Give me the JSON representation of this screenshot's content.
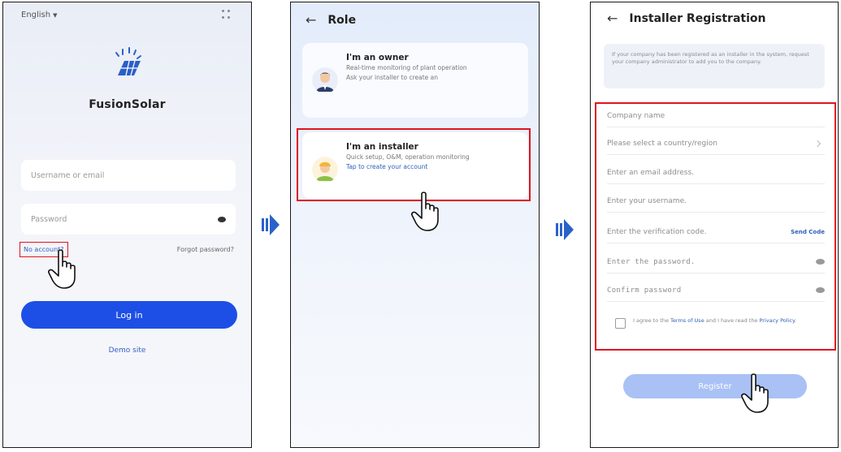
{
  "login": {
    "language": "English",
    "brand": "FusionSolar",
    "username_placeholder": "Username or email",
    "password_placeholder": "Password",
    "no_account": "No account?",
    "forgot_password": "Forgot password?",
    "login_button": "Log in",
    "demo_site": "Demo site"
  },
  "role": {
    "title": "Role",
    "owner": {
      "title": "I'm an owner",
      "desc": "Real-time monitoring of plant operation",
      "note": "Ask your installer to create an"
    },
    "installer": {
      "title": "I'm an installer",
      "desc": "Quick setup, O&M, operation monitoring",
      "link": "Tap to create your account"
    }
  },
  "registration": {
    "title": "Installer Registration",
    "notice": "If your company has been registered as an installer in the system, request your company administrator to add you to the company.",
    "fields": {
      "company": "Company name",
      "country": "Please select a country/region",
      "email": "Enter an email address.",
      "username": "Enter your username.",
      "code": "Enter the verification code.",
      "send_code": "Send Code",
      "password": "Enter the password.",
      "confirm": "Confirm password"
    },
    "agree_prefix": "I agree to the ",
    "terms": "Terms of Use",
    "agree_mid": " and I have read the ",
    "privacy": "Privacy Policy",
    "agree_suffix": ".",
    "register_button": "Register"
  },
  "colors": {
    "accent": "#1d4fe6",
    "highlight": "#e0141e",
    "arrow": "#2a62c9"
  },
  "icons": {
    "back": "arrow-left-icon",
    "cursor": "hand-pointer-icon",
    "flow": "flow-arrow-right-icon"
  }
}
